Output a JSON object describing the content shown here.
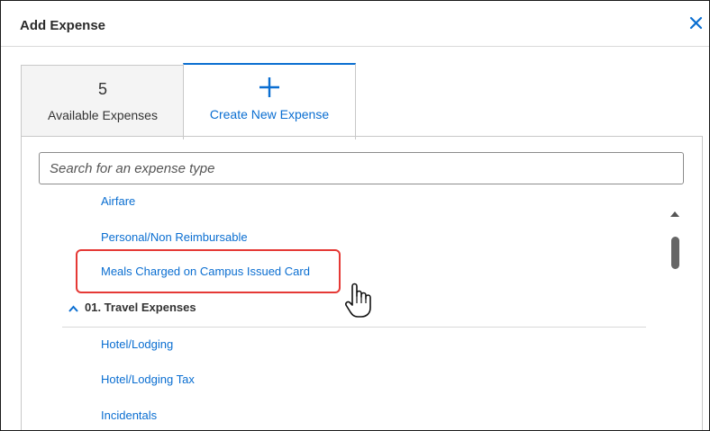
{
  "dialog": {
    "title": "Add Expense",
    "close_icon": "close-icon"
  },
  "tabs": [
    {
      "count": "5",
      "label": "Available Expenses",
      "active": false
    },
    {
      "icon": "plus-icon",
      "label": "Create New Expense",
      "active": true
    }
  ],
  "search": {
    "placeholder": "Search for an expense type",
    "value": ""
  },
  "expense_types": {
    "items_before": [
      "Airfare",
      "Personal/Non Reimbursable",
      "Meals Charged on Campus Issued Card"
    ],
    "group": {
      "label": "01. Travel Expenses",
      "icon": "chevron-up-icon",
      "expanded": true
    },
    "items_after": [
      "Hotel/Lodging",
      "Hotel/Lodging Tax",
      "Incidentals"
    ]
  },
  "colors": {
    "accent": "#0a6ed1",
    "highlight": "#e53935",
    "text": "#333333"
  }
}
